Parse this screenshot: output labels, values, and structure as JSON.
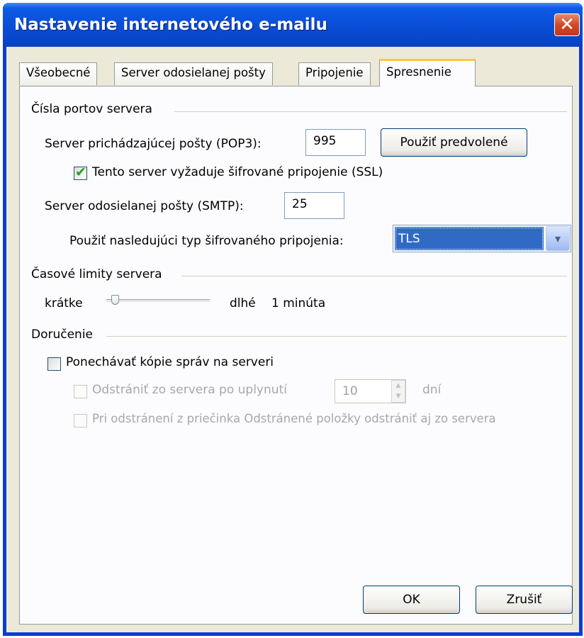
{
  "window": {
    "title": "Nastavenie internetového e-mailu",
    "close_glyph": "✕"
  },
  "tabs": [
    {
      "label": "Všeobecné",
      "selected": false
    },
    {
      "label": "Server odosielanej pošty",
      "selected": false
    },
    {
      "label": "Pripojenie",
      "selected": false
    },
    {
      "label": "Spresnenie",
      "selected": true
    }
  ],
  "ports_group": {
    "title": "Čísla portov servera",
    "incoming_label": "Server prichádzajúcej pošty (POP3):",
    "incoming_port": "995",
    "use_defaults_button": "Použiť predvolené",
    "ssl_checkbox_label": "Tento server vyžaduje šifrované pripojenie (SSL)",
    "ssl_checked": true,
    "outgoing_label": "Server odosielanej pošty (SMTP):",
    "outgoing_port": "25",
    "encryption_label": "Použiť nasledujúci typ šifrovaného pripojenia:",
    "encryption_value": "TLS"
  },
  "timeouts_group": {
    "title": "Časové limity servera",
    "short_label": "krátke",
    "long_label": "dlhé",
    "value_text": "1 minúta",
    "slider_level": 0.05
  },
  "delivery_group": {
    "title": "Doručenie",
    "keep_copies_label": "Ponechávať kópie správ na serveri",
    "keep_copies_checked": false,
    "remove_after_label": "Odstrániť zo servera po uplynutí",
    "remove_after_days": "10",
    "days_unit": "dní",
    "remove_on_delete_label": "Pri odstránení z priečinka Odstránené položky odstrániť aj zo servera"
  },
  "footer": {
    "ok_label": "OK",
    "cancel_label": "Zrušiť"
  },
  "icons": {
    "check": "✔",
    "dropdown": "▾",
    "spin_up": "▲",
    "spin_down": "▼"
  },
  "colors": {
    "titlebar": "#0a4ed8",
    "dialog_bg": "#ece9d8",
    "selection": "#316ac5",
    "tab_highlight": "#ffc83c"
  }
}
